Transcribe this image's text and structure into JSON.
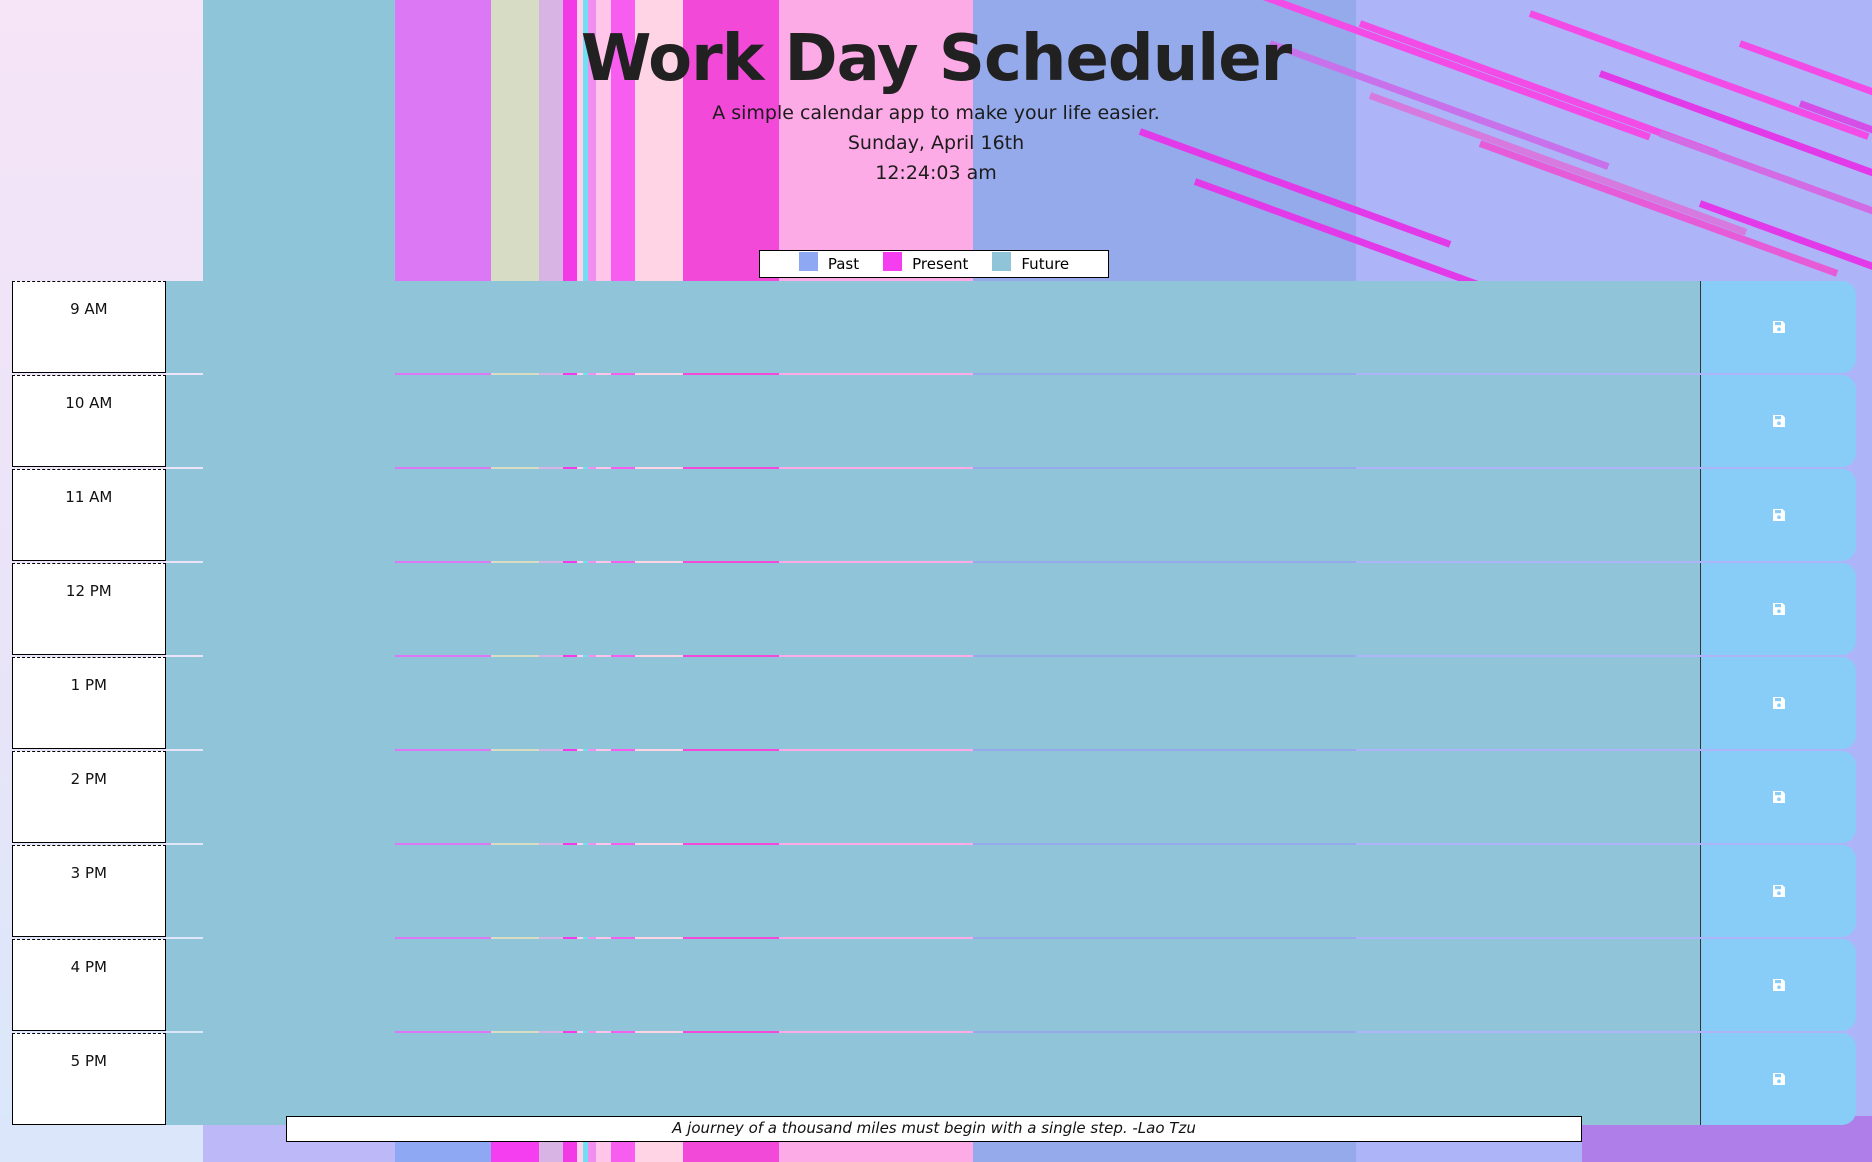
{
  "header": {
    "title": "Work Day Scheduler",
    "subtitle": "A simple calendar app to make your life easier.",
    "date": "Sunday, April 16th",
    "time": "12:24:03 am"
  },
  "legend": {
    "items": [
      {
        "label": "Past",
        "color": "#8fa8f4"
      },
      {
        "label": "Present",
        "color": "#f43ef0"
      },
      {
        "label": "Future",
        "color": "#90c4d8"
      }
    ]
  },
  "schedule": {
    "rows": [
      {
        "hour": "9 AM",
        "text": "",
        "state": "future"
      },
      {
        "hour": "10 AM",
        "text": "",
        "state": "future"
      },
      {
        "hour": "11 AM",
        "text": "",
        "state": "future"
      },
      {
        "hour": "12 PM",
        "text": "",
        "state": "future"
      },
      {
        "hour": "1 PM",
        "text": "",
        "state": "future"
      },
      {
        "hour": "2 PM",
        "text": "",
        "state": "future"
      },
      {
        "hour": "3 PM",
        "text": "",
        "state": "future"
      },
      {
        "hour": "4 PM",
        "text": "",
        "state": "future"
      },
      {
        "hour": "5 PM",
        "text": "",
        "state": "future"
      }
    ],
    "save_icon": "floppy-disk-icon"
  },
  "footer": {
    "quote": "A journey of a thousand miles must begin with a single step. -Lao Tzu"
  },
  "colors": {
    "future": "#90c4d8",
    "save_button": "#88cdf8"
  }
}
